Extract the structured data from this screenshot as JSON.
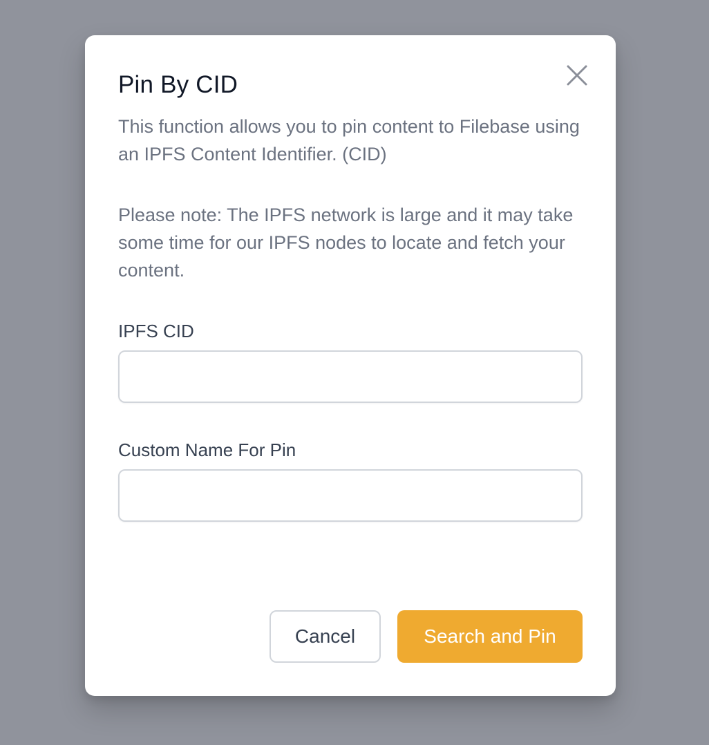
{
  "modal": {
    "title": "Pin By CID",
    "description": "This function allows you to pin content to Filebase using an IPFS Content Identifier. (CID)",
    "note": "Please note: The IPFS network is large and it may take some time for our IPFS nodes to locate and fetch your content.",
    "close_icon": "close-icon"
  },
  "form": {
    "cid_label": "IPFS CID",
    "cid_value": "",
    "cid_placeholder": "",
    "name_label": "Custom Name For Pin",
    "name_value": "",
    "name_placeholder": ""
  },
  "actions": {
    "cancel_label": "Cancel",
    "submit_label": "Search and Pin"
  },
  "colors": {
    "overlay": "#90939c",
    "accent": "#efaa30",
    "title": "#111827",
    "body_text": "#6b7280"
  }
}
